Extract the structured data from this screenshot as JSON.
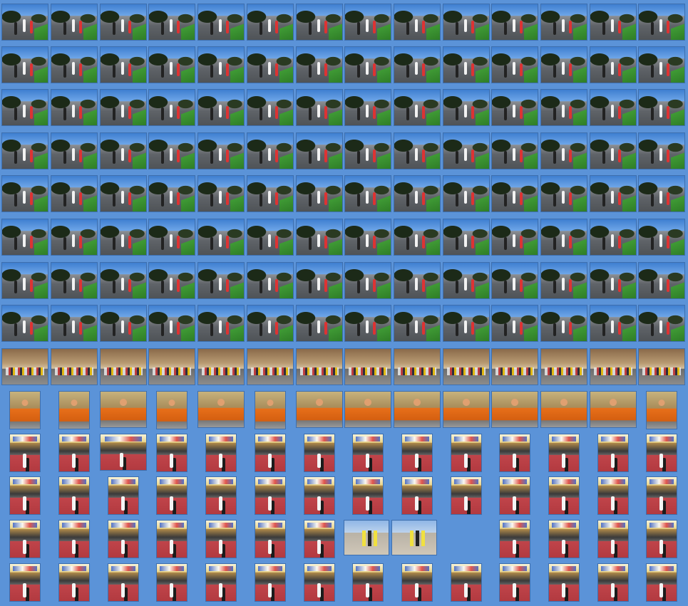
{
  "sheet": {
    "background_color": "#5b93d8",
    "thumbnail_rows": 14,
    "scene_kinds": [
      "road-race",
      "town-street",
      "people-portrait",
      "finish-line",
      "plaza"
    ]
  },
  "rows": [
    {
      "kind": "road",
      "count": 14
    },
    {
      "kind": "road",
      "count": 14
    },
    {
      "kind": "road",
      "count": 14
    },
    {
      "kind": "road",
      "count": 14
    },
    {
      "kind": "road",
      "count": 14
    },
    {
      "kind": "road",
      "count": 14
    },
    {
      "kind": "road",
      "count": 14
    },
    {
      "kind": "road",
      "count": 14
    },
    {
      "kind": "town",
      "count": 14
    },
    {
      "kind": "people",
      "count": 14
    },
    {
      "kind": "finish",
      "count": 14
    },
    {
      "kind": "finish",
      "count": 14
    },
    {
      "kind": "finish",
      "count": 13
    },
    {
      "kind": "finish",
      "count": 14
    }
  ]
}
